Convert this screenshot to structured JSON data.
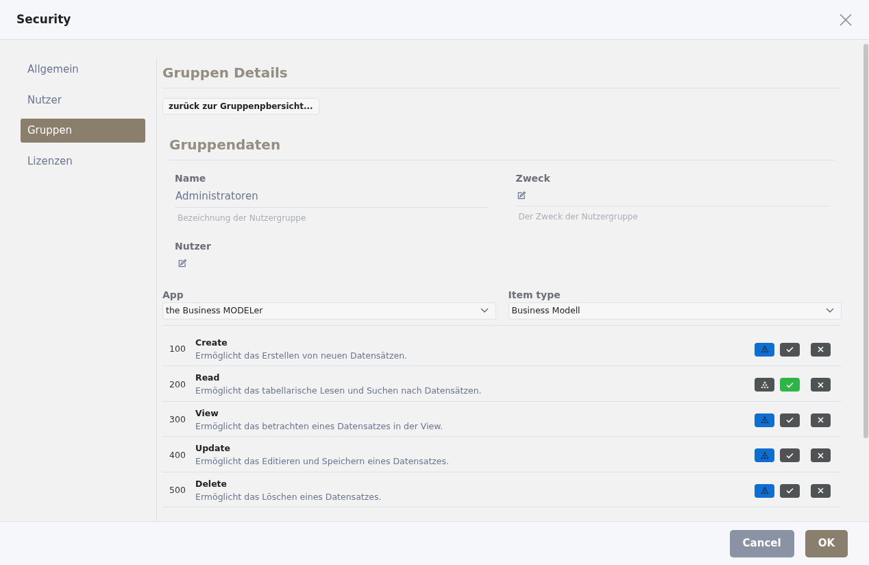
{
  "dialog": {
    "title": "Security"
  },
  "sidebar": {
    "items": [
      {
        "label": "Allgemein",
        "selected": false
      },
      {
        "label": "Nutzer",
        "selected": false
      },
      {
        "label": "Gruppen",
        "selected": true
      },
      {
        "label": "Lizenzen",
        "selected": false
      }
    ]
  },
  "details": {
    "title": "Gruppen Details",
    "back_button": "zurück zur Gruppenpbersicht...",
    "section_title": "Gruppendaten",
    "fields": [
      {
        "label": "Name",
        "value": "Administratoren",
        "hint": "Bezeichnung der Nutzergruppe"
      },
      {
        "label": "Zweck",
        "hint": "Der Zweck der Nutzergruppe"
      }
    ],
    "users": {
      "label": "Nutzer"
    }
  },
  "filters": [
    {
      "label": "App",
      "value": "the Business MODELer"
    },
    {
      "label": "Item type",
      "value": "Business Modell"
    }
  ],
  "permissions": [
    {
      "code": "100",
      "name": "Create",
      "description": "Ermöglicht das Erstellen von neuen Datensätzen.",
      "inherited": true,
      "allowed": false,
      "denied": false
    },
    {
      "code": "200",
      "name": "Read",
      "description": "Ermöglicht das tabellarische Lesen und Suchen nach Datensätzen.",
      "inherited": false,
      "allowed": true,
      "denied": false
    },
    {
      "code": "300",
      "name": "View",
      "description": "Ermöglicht das betrachten eines Datensatzes in der View.",
      "inherited": true,
      "allowed": false,
      "denied": false
    },
    {
      "code": "400",
      "name": "Update",
      "description": "Ermöglicht das Editieren und Speichern eines Datensatzes.",
      "inherited": true,
      "allowed": false,
      "denied": false
    },
    {
      "code": "500",
      "name": "Delete",
      "description": "Ermöglicht das Löschen eines Datensatzes.",
      "inherited": true,
      "allowed": false,
      "denied": false
    }
  ],
  "footer": {
    "buttons": [
      "Cancel",
      "OK"
    ]
  }
}
